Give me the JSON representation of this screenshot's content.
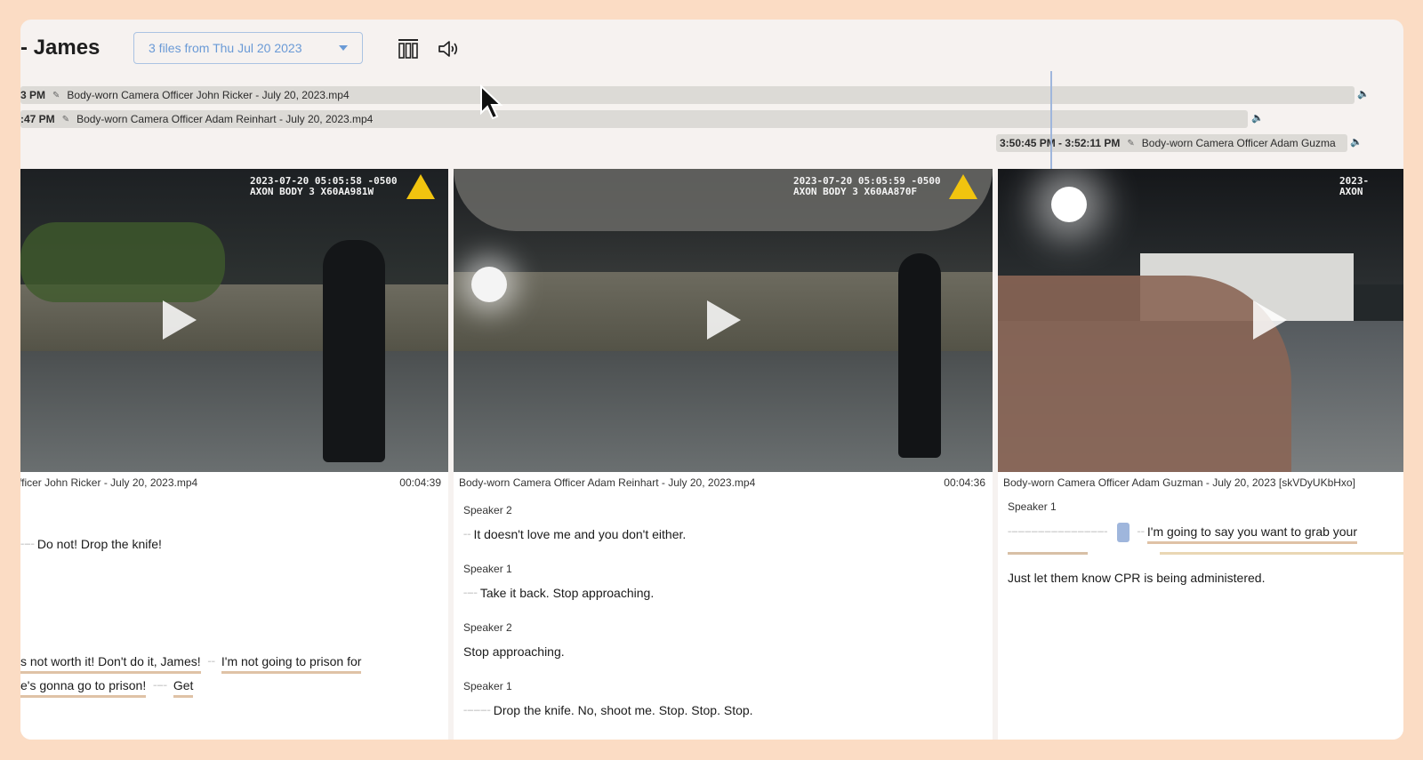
{
  "header": {
    "title": "- James",
    "file_select": "3 files from Thu Jul 20 2023"
  },
  "timeline": {
    "tracks": [
      {
        "time": "3 PM",
        "name": "Body-worn Camera Officer John Ricker - July 20, 2023.mp4"
      },
      {
        "time": ":47 PM",
        "name": "Body-worn Camera Officer Adam Reinhart - July 20, 2023.mp4"
      },
      {
        "time": "3:50:45 PM - 3:52:11 PM",
        "name": "Body-worn Camera Officer Adam Guzma"
      }
    ]
  },
  "videos": [
    {
      "stamp": "2023-07-20 05:05:58 -0500\nAXON BODY 3 X60AA981W",
      "file": "fficer John Ricker - July 20, 2023.mp4",
      "duration": "00:04:39",
      "transcript": [
        {
          "text": "Do not! Drop the knife!"
        },
        {
          "text_a": "s not worth it! Don't do it, James!",
          "text_b": "I'm not going to prison for"
        },
        {
          "text_a": "e's gonna go to prison!",
          "text_b": "Get"
        }
      ]
    },
    {
      "stamp": "2023-07-20 05:05:59 -0500\nAXON BODY 3 X60AA870F",
      "file": "Body-worn Camera Officer Adam Reinhart - July 20, 2023.mp4",
      "duration": "00:04:36",
      "transcript": [
        {
          "speaker": "Speaker 2",
          "text": "It doesn't love me and you don't either."
        },
        {
          "speaker": "Speaker 1",
          "text": "Take it back. Stop approaching."
        },
        {
          "speaker": "Speaker 2",
          "text": "Stop approaching."
        },
        {
          "speaker": "Speaker 1",
          "text": "Drop the knife. No, shoot me. Stop. Stop. Stop."
        }
      ]
    },
    {
      "stamp": "2023-\nAXON",
      "file": "Body-worn Camera Officer Adam Guzman - July 20, 2023 [skVDyUKbHxo]",
      "duration": "",
      "transcript": [
        {
          "speaker": "Speaker 1",
          "text": "I'm going to say you want to grab your"
        },
        {
          "text": "Just let them know CPR is being administered."
        }
      ]
    }
  ],
  "colors": {
    "background": "#fbdcc4",
    "accent": "#6a9ad6",
    "playhead": "#9fb6dc",
    "underline": "#dfc2a6"
  }
}
